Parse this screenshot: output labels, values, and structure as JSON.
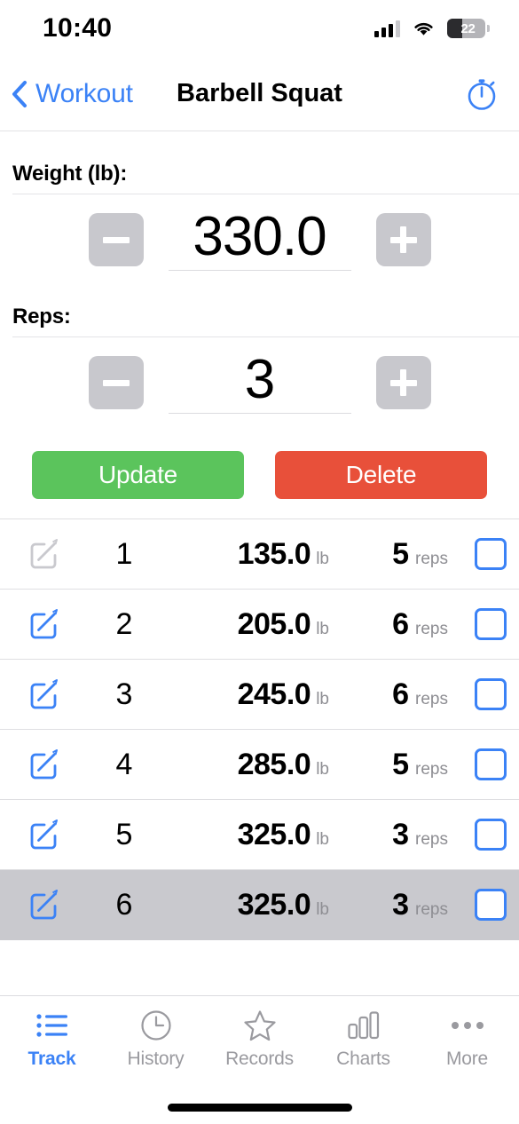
{
  "status_bar": {
    "time": "10:40",
    "battery_percent": "22",
    "signal_icon": "cellular-signal-icon",
    "wifi_icon": "wifi-icon",
    "battery_icon": "battery-icon"
  },
  "nav_bar": {
    "back_label": "Workout",
    "back_icon": "chevron-left-icon",
    "title": "Barbell Squat",
    "timer_icon": "stopwatch-icon"
  },
  "form": {
    "weight": {
      "label": "Weight (lb):",
      "value": "330.0",
      "decrement_label": "−",
      "increment_label": "+"
    },
    "reps": {
      "label": "Reps:",
      "value": "3",
      "decrement_label": "−",
      "increment_label": "+"
    }
  },
  "actions": {
    "update_label": "Update",
    "delete_label": "Delete",
    "update_color": "#5bc45c",
    "delete_color": "#e8503a"
  },
  "set_list": {
    "units": {
      "weight": "lb",
      "reps": "reps"
    },
    "rows": [
      {
        "index": "1",
        "weight": "135.0",
        "reps": "5",
        "edit_enabled": false,
        "checked": false,
        "selected": false
      },
      {
        "index": "2",
        "weight": "205.0",
        "reps": "6",
        "edit_enabled": true,
        "checked": false,
        "selected": false
      },
      {
        "index": "3",
        "weight": "245.0",
        "reps": "6",
        "edit_enabled": true,
        "checked": false,
        "selected": false
      },
      {
        "index": "4",
        "weight": "285.0",
        "reps": "5",
        "edit_enabled": true,
        "checked": false,
        "selected": false
      },
      {
        "index": "5",
        "weight": "325.0",
        "reps": "3",
        "edit_enabled": true,
        "checked": false,
        "selected": false
      },
      {
        "index": "6",
        "weight": "325.0",
        "reps": "3",
        "edit_enabled": true,
        "checked": false,
        "selected": true
      }
    ]
  },
  "tab_bar": {
    "active_index": 0,
    "accent_color": "#3b82f6",
    "inactive_color": "#9a9a9f",
    "items": [
      {
        "label": "Track",
        "icon": "list-icon"
      },
      {
        "label": "History",
        "icon": "clock-icon"
      },
      {
        "label": "Records",
        "icon": "star-icon"
      },
      {
        "label": "Charts",
        "icon": "bar-chart-icon"
      },
      {
        "label": "More",
        "icon": "ellipsis-icon"
      }
    ]
  }
}
